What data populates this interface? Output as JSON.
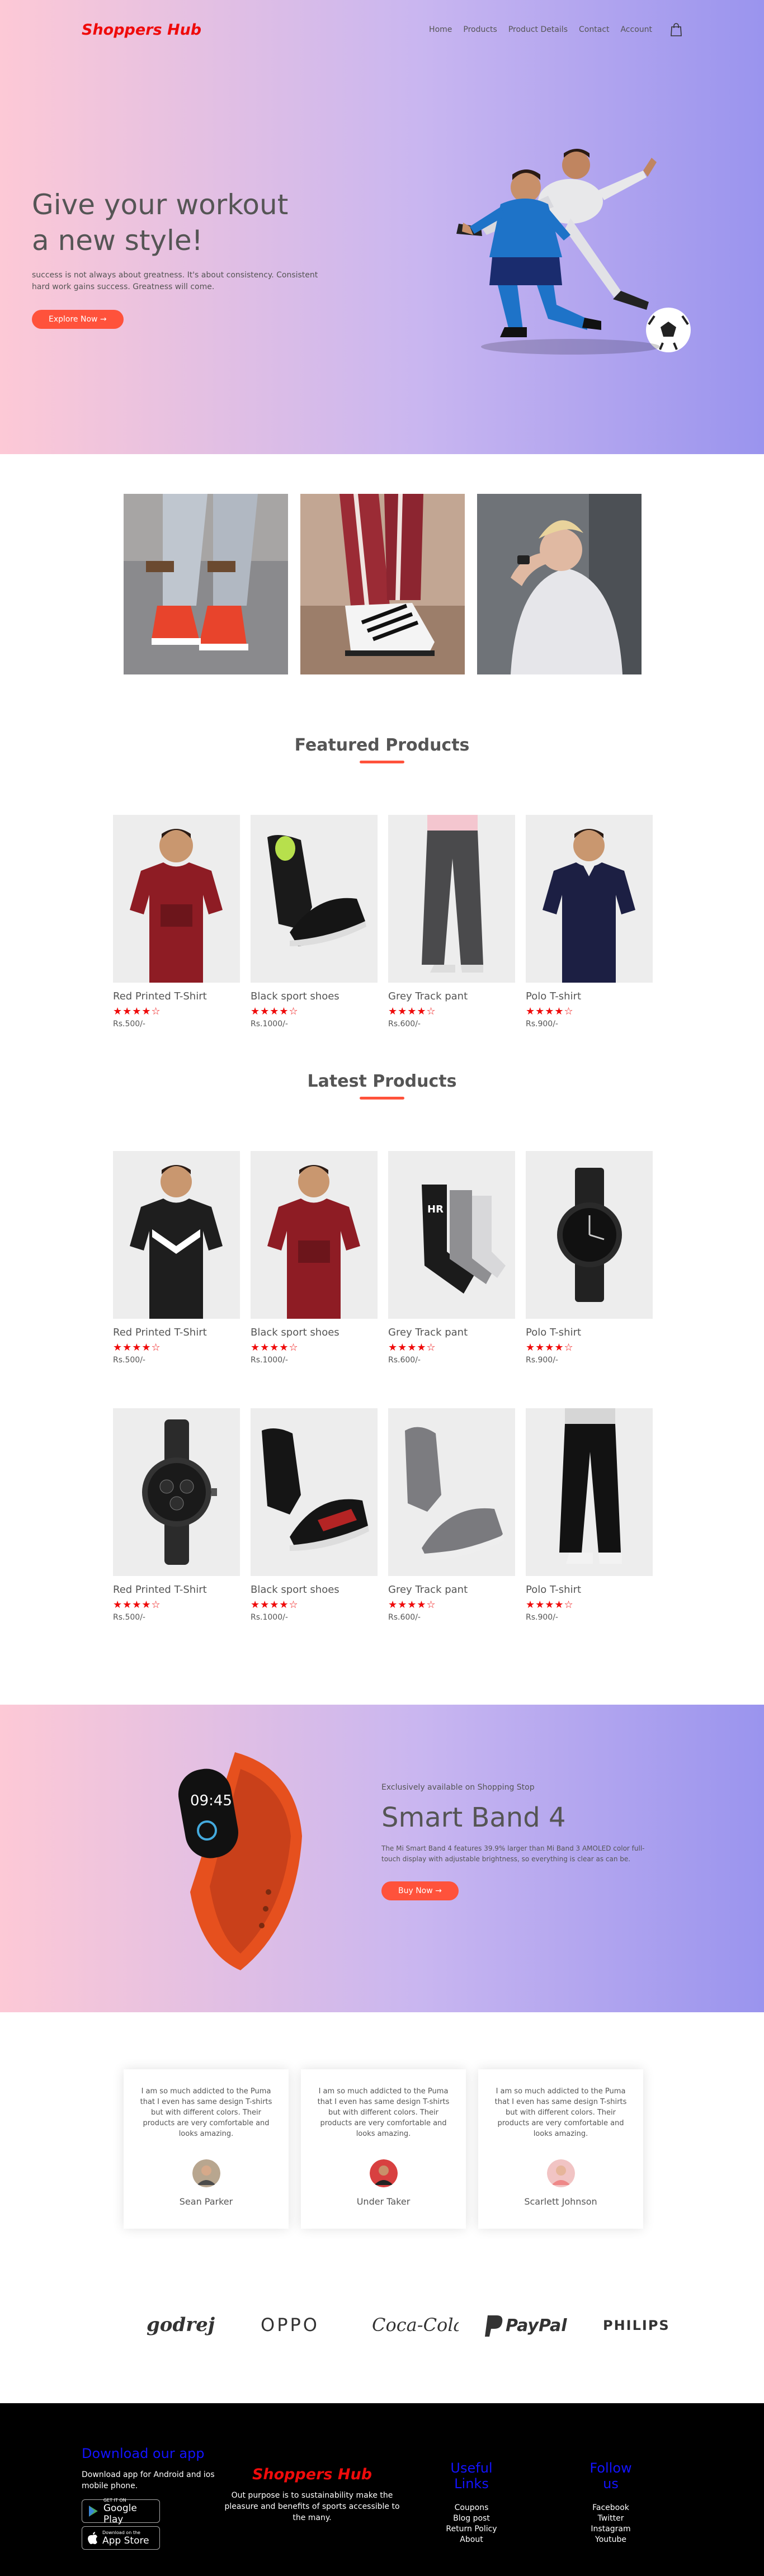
{
  "brand": {
    "name": "Shoppers Hub",
    "accent": "#ff523b",
    "logo_color": "#ef0b0b"
  },
  "nav": {
    "items": [
      "Home",
      "Products",
      "Product Details",
      "Contact",
      "Account"
    ],
    "cart_icon": "shopping-bag-icon"
  },
  "hero": {
    "title_line1": "Give your workout",
    "title_line2": "a new style!",
    "subtitle": "success is not always about greatness. It's about consistency. Consistent hard work gains success. Greatness will come.",
    "cta": "Explore Now →"
  },
  "featured": {
    "title": "Featured Products",
    "products": [
      {
        "name": "Red Printed T-Shirt",
        "rating": 4,
        "price": "Rs.500/-"
      },
      {
        "name": "Black sport shoes",
        "rating": 4,
        "price": "Rs.1000/-"
      },
      {
        "name": "Grey Track pant",
        "rating": 4,
        "price": "Rs.600/-"
      },
      {
        "name": "Polo T-shirt",
        "rating": 4,
        "price": "Rs.900/-"
      }
    ]
  },
  "latest": {
    "title": "Latest Products",
    "row1": [
      {
        "name": "Red Printed T-Shirt",
        "rating": 4,
        "price": "Rs.500/-"
      },
      {
        "name": "Black sport shoes",
        "rating": 4,
        "price": "Rs.1000/-"
      },
      {
        "name": "Grey Track pant",
        "rating": 4,
        "price": "Rs.600/-"
      },
      {
        "name": "Polo T-shirt",
        "rating": 4,
        "price": "Rs.900/-"
      }
    ],
    "row2": [
      {
        "name": "Red Printed T-Shirt",
        "rating": 4,
        "price": "Rs.500/-"
      },
      {
        "name": "Black sport shoes",
        "rating": 4,
        "price": "Rs.1000/-"
      },
      {
        "name": "Grey Track pant",
        "rating": 4,
        "price": "Rs.600/-"
      },
      {
        "name": "Polo T-shirt",
        "rating": 4,
        "price": "Rs.900/-"
      }
    ]
  },
  "offer": {
    "small": "Exclusively available on Shopping Stop",
    "title": "Smart Band 4",
    "desc": "The Mi Smart Band 4 features 39.9% larger than Mi Band 3 AMOLED color full-touch display with adjustable brightness, so everything is clear as can be.",
    "cta": "Buy Now →"
  },
  "testimonials": {
    "quote": "I am so much addicted to the Puma that I even has same design T-shirts but with different colors. Their products are very comfortable and looks amazing.",
    "people": [
      "Sean Parker",
      "Under Taker",
      "Scarlett Johnson"
    ]
  },
  "brands": [
    "godrej",
    "OPPO",
    "Coca-Cola",
    "PayPal",
    "PHILIPS"
  ],
  "footer": {
    "download_title": "Download our app",
    "download_text": "Download app for Android and ios mobile phone.",
    "google_small": "GET IT ON",
    "google_big": "Google Play",
    "apple_small": "Download on the",
    "apple_big": "App Store",
    "brand_name": "Shoppers Hub",
    "brand_text": "Out purpose is to sustainability make the pleasure and benefits of sports accessible to the many.",
    "useful_title": "Useful Links",
    "useful_links": [
      "Coupons",
      "Blog post",
      "Return Policy",
      "About"
    ],
    "follow_title": "Follow us",
    "follow_links": [
      "Facebook",
      "Twitter",
      "Instagram",
      "Youtube"
    ]
  }
}
